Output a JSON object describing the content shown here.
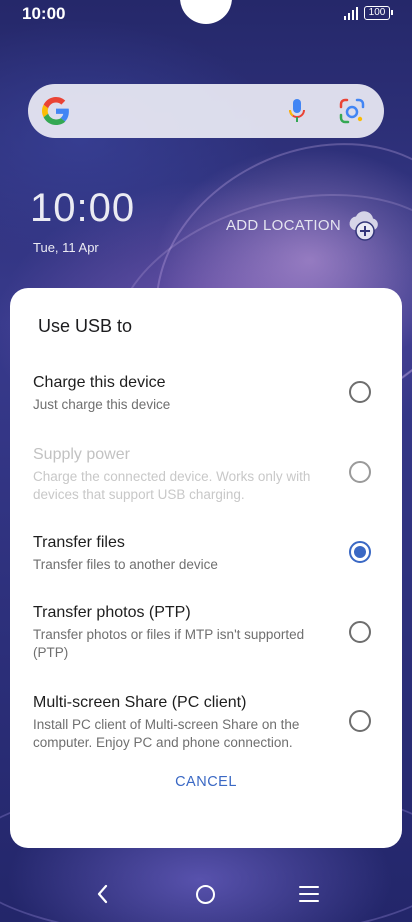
{
  "status_bar": {
    "time": "10:00",
    "battery": "100"
  },
  "search_bar": {
    "logo": "google-g-logo",
    "mic_icon": "microphone-icon",
    "lens_icon": "google-lens-icon"
  },
  "clock_widget": {
    "time": "10:00",
    "date": "Tue, 11 Apr",
    "add_location": "ADD LOCATION"
  },
  "usb_dialog": {
    "title": "Use USB to",
    "options": [
      {
        "title": "Charge this device",
        "desc": "Just charge this device",
        "enabled": true,
        "selected": false
      },
      {
        "title": "Supply power",
        "desc": "Charge the connected device. Works only with devices that support USB charging.",
        "enabled": false,
        "selected": false
      },
      {
        "title": "Transfer files",
        "desc": "Transfer files to another device",
        "enabled": true,
        "selected": true
      },
      {
        "title": "Transfer photos (PTP)",
        "desc": "Transfer photos or files if MTP isn't supported (PTP)",
        "enabled": true,
        "selected": false
      },
      {
        "title": "Multi-screen Share (PC client)",
        "desc": "Install PC client of Multi-screen Share on the computer. Enjoy PC and phone connection.",
        "enabled": true,
        "selected": false
      }
    ],
    "cancel_label": "CANCEL"
  },
  "nav_bar": {
    "back": "back-icon",
    "home": "home-icon",
    "recents": "menu-icon"
  },
  "colors": {
    "accent": "#3a68c4",
    "dialog_bg": "#ffffff"
  }
}
